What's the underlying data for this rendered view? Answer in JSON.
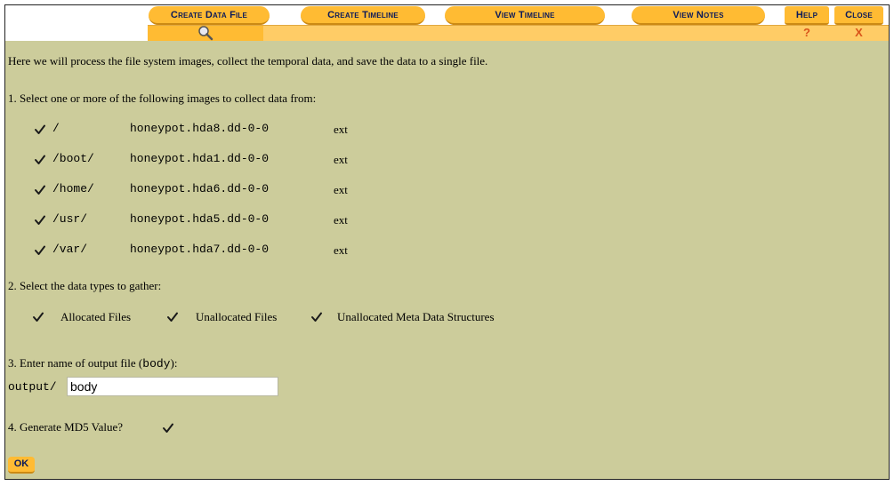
{
  "toolbar": {
    "tabs": [
      {
        "label": "Create Data File"
      },
      {
        "label": "Create Timeline"
      },
      {
        "label": "View Timeline"
      },
      {
        "label": "View Notes"
      },
      {
        "label": "Help"
      },
      {
        "label": "Close"
      }
    ],
    "help_symbol": "?",
    "close_symbol": "X",
    "active_icon": "magnifier-icon"
  },
  "intro": "Here we will process the file system images, collect the temporal data, and save the data to a single file.",
  "step1": {
    "label": "1. Select one or more of the following images to collect data from:",
    "images": [
      {
        "mount": "/",
        "file": "honeypot.hda8.dd-0-0",
        "fs": "ext",
        "checked": true
      },
      {
        "mount": "/boot/",
        "file": "honeypot.hda1.dd-0-0",
        "fs": "ext",
        "checked": true
      },
      {
        "mount": "/home/",
        "file": "honeypot.hda6.dd-0-0",
        "fs": "ext",
        "checked": true
      },
      {
        "mount": "/usr/",
        "file": "honeypot.hda5.dd-0-0",
        "fs": "ext",
        "checked": true
      },
      {
        "mount": "/var/",
        "file": "honeypot.hda7.dd-0-0",
        "fs": "ext",
        "checked": true
      }
    ]
  },
  "step2": {
    "label": "2. Select the data types to gather:",
    "types": [
      {
        "label": "Allocated Files",
        "checked": true
      },
      {
        "label": "Unallocated Files",
        "checked": true
      },
      {
        "label": "Unallocated Meta Data Structures",
        "checked": true
      }
    ]
  },
  "step3": {
    "label_prefix": "3. Enter name of output file (",
    "label_code": "body",
    "label_suffix": "):",
    "path_prefix": "output/",
    "value": "body"
  },
  "step4": {
    "label": "4. Generate MD5 Value?",
    "checked": true
  },
  "ok_label": "OK",
  "colors": {
    "background": "#cccc9b",
    "tab": "#ffbb33",
    "tab_text": "#0a1a5a",
    "symbol": "#d9541a"
  }
}
